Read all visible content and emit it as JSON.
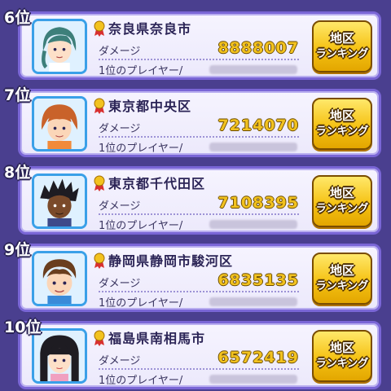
{
  "rankings": [
    {
      "rank": "6位",
      "region": "奈良県奈良市",
      "damage_label": "ダメージ",
      "damage": "8888007",
      "player_label": "1位のプレイヤー/",
      "button_line1": "地区",
      "button_line2": "ランキング",
      "avatar": "character-avatar-green-hair"
    },
    {
      "rank": "7位",
      "region": "東京都中央区",
      "damage_label": "ダメージ",
      "damage": "7214070",
      "player_label": "1位のプレイヤー/",
      "button_line1": "地区",
      "button_line2": "ランキング",
      "avatar": "character-avatar-orange-hair"
    },
    {
      "rank": "8位",
      "region": "東京都千代田区",
      "damage_label": "ダメージ",
      "damage": "7108395",
      "player_label": "1位のプレイヤー/",
      "button_line1": "地区",
      "button_line2": "ランキング",
      "avatar": "character-avatar-dark-spiky-hair"
    },
    {
      "rank": "9位",
      "region": "静岡県静岡市駿河区",
      "damage_label": "ダメージ",
      "damage": "6835135",
      "player_label": "1位のプレイヤー/",
      "button_line1": "地区",
      "button_line2": "ランキング",
      "avatar": "character-avatar-brown-hair"
    },
    {
      "rank": "10位",
      "region": "福島県南相馬市",
      "damage_label": "ダメージ",
      "damage": "6572419",
      "player_label": "1位のプレイヤー/",
      "button_line1": "地区",
      "button_line2": "ランキング",
      "avatar": "character-avatar-black-hair-girl"
    }
  ],
  "colors": {
    "background": "#4a3f8f",
    "card_border": "#7a66d6",
    "damage_gold": "#f2c21f",
    "button_gold": "#f5c214"
  }
}
